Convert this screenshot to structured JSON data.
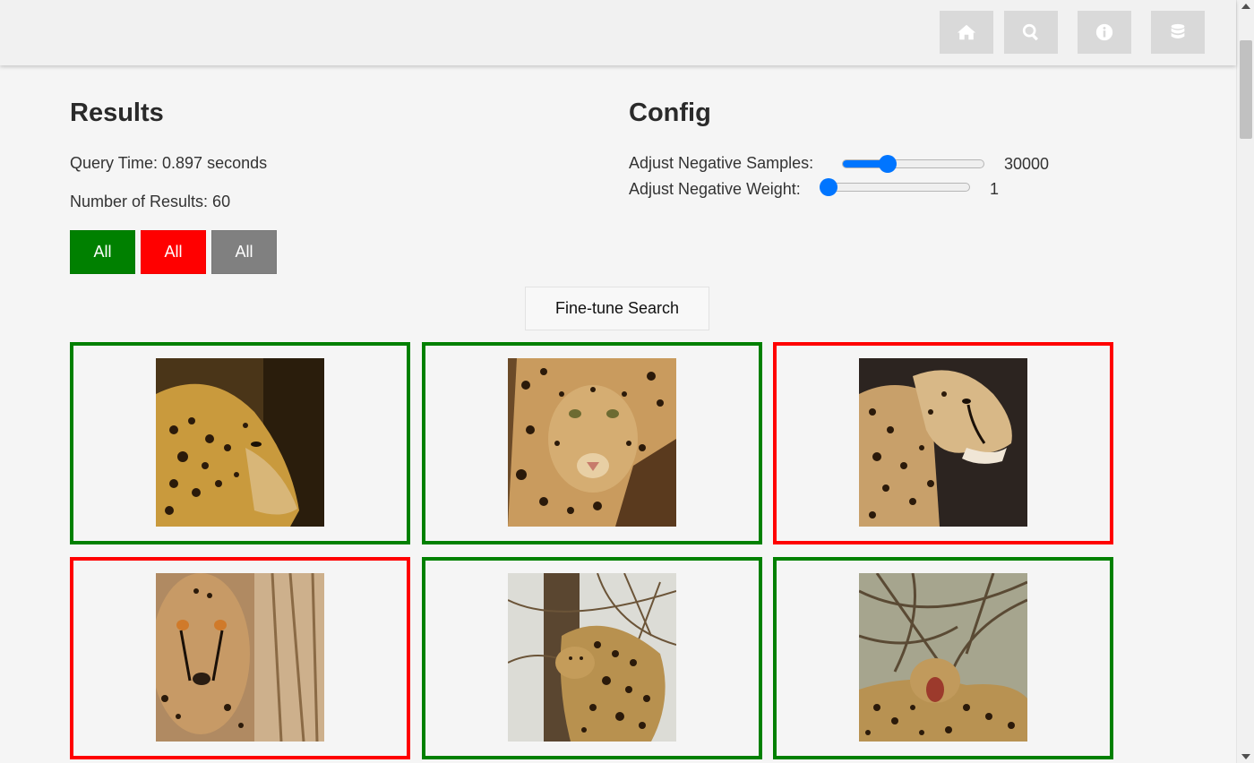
{
  "nav": {
    "buttons": [
      {
        "name": "home-button",
        "icon": "home-icon"
      },
      {
        "name": "search-button",
        "icon": "search-icon"
      },
      {
        "name": "info-button",
        "icon": "info-icon"
      },
      {
        "name": "database-button",
        "icon": "database-icon"
      }
    ]
  },
  "results": {
    "title": "Results",
    "query_time": "Query Time: 0.897 seconds",
    "num_results": "Number of Results: 60",
    "filters": [
      {
        "label": "All",
        "color": "#008000"
      },
      {
        "label": "All",
        "color": "#ff0000"
      },
      {
        "label": "All",
        "color": "#808080"
      }
    ]
  },
  "config": {
    "title": "Config",
    "negative_samples": {
      "label": "Adjust Negative Samples:",
      "value": "30000",
      "fraction": 0.32
    },
    "negative_weight": {
      "label": "Adjust Negative Weight:",
      "value": "1",
      "fraction": 0.0
    }
  },
  "finetune": {
    "label": "Fine-tune Search"
  },
  "grid": {
    "cards": [
      {
        "label": "positive",
        "border_color": "#008000",
        "subject": "leopard-profile"
      },
      {
        "label": "positive",
        "border_color": "#008000",
        "subject": "leopard-face"
      },
      {
        "label": "negative",
        "border_color": "#ff0000",
        "subject": "cheetah-profile"
      },
      {
        "label": "negative",
        "border_color": "#ff0000",
        "subject": "cheetah-face"
      },
      {
        "label": "positive",
        "border_color": "#008000",
        "subject": "leopard-in-tree"
      },
      {
        "label": "positive",
        "border_color": "#008000",
        "subject": "leopard-yawning"
      }
    ]
  },
  "colors": {
    "accent": "#0075ff",
    "positive": "#008000",
    "negative": "#ff0000",
    "neutral": "#808080"
  }
}
